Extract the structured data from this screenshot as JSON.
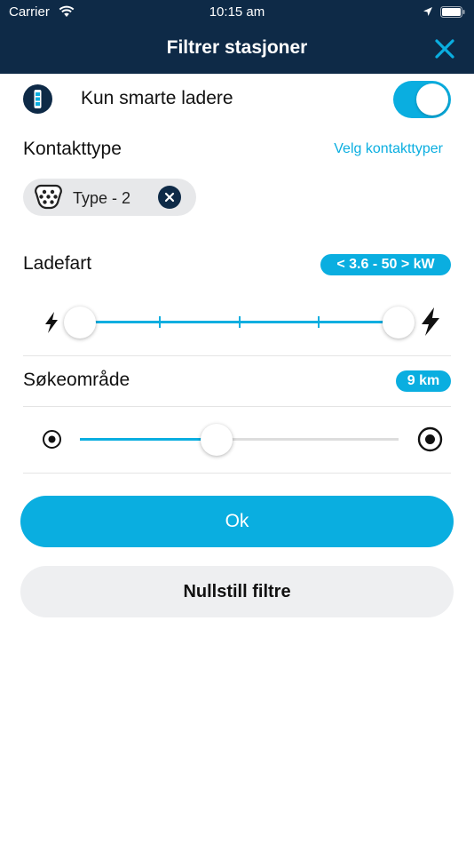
{
  "status_bar": {
    "carrier": "Carrier",
    "time": "10:15 am"
  },
  "header": {
    "title": "Filtrer stasjoner"
  },
  "smart_chargers": {
    "label": "Kun smarte ladere",
    "enabled": true
  },
  "connector": {
    "title": "Kontakttype",
    "select_link": "Velg kontakttyper",
    "chips": [
      {
        "label": "Type - 2"
      }
    ]
  },
  "charge_speed": {
    "title": "Ladefart",
    "badge": "< 3.6 - 50 > kW",
    "range_fraction": [
      0,
      1
    ],
    "steps": 4
  },
  "search_radius": {
    "title": "Søkeområde",
    "badge": "9 km",
    "level_fraction": 0.43
  },
  "buttons": {
    "ok": "Ok",
    "reset": "Nullstill filtre"
  },
  "colors": {
    "header_bg": "#0e2a47",
    "accent": "#0aaee0",
    "chip_bg": "#e7e8ea",
    "secondary_button_bg": "#eeeff1"
  }
}
